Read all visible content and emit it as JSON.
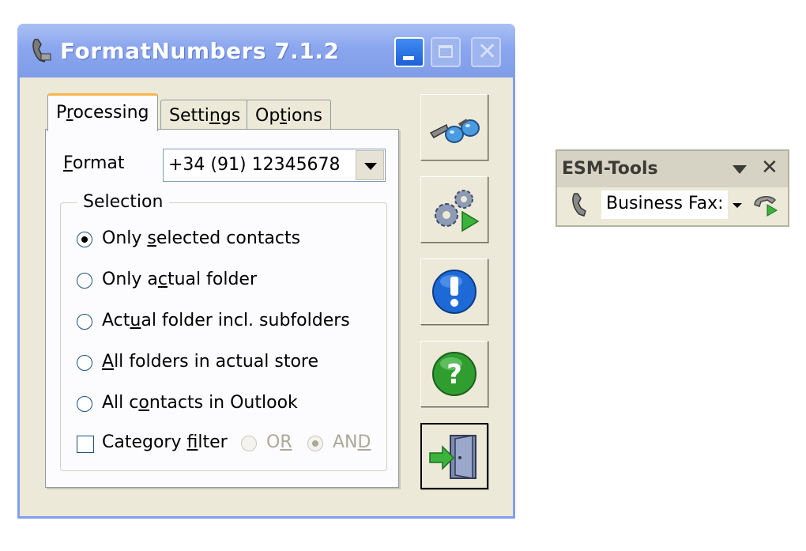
{
  "window": {
    "title": "FormatNumbers 7.1.2",
    "controls": {
      "minimize": "minimize",
      "maximize": "maximize",
      "close": "close"
    }
  },
  "tabs": [
    {
      "pre": "P",
      "ul": "r",
      "post": "ocessing"
    },
    {
      "pre": "Setti",
      "ul": "n",
      "post": "gs"
    },
    {
      "pre": "Op",
      "ul": "t",
      "post": "ions"
    }
  ],
  "format": {
    "label_ul": "F",
    "label_rest": "ormat",
    "value": "+34 (91) 12345678"
  },
  "selection": {
    "title": "Selection",
    "options": [
      {
        "pre": "Only ",
        "ul": "s",
        "post": "elected contacts",
        "selected": true
      },
      {
        "pre": "Only a",
        "ul": "c",
        "post": "tual folder",
        "selected": false
      },
      {
        "pre": "Act",
        "ul": "u",
        "post": "al folder incl. subfolders",
        "selected": false
      },
      {
        "pre": "",
        "ul": "A",
        "post": "ll folders in actual store",
        "selected": false
      },
      {
        "pre": "All c",
        "ul": "o",
        "post": "ntacts in Outlook",
        "selected": false
      }
    ],
    "category_filter": {
      "pre": "Category ",
      "ul": "f",
      "post": "ilter",
      "checked": false
    },
    "or": {
      "pre": "O",
      "ul": "R",
      "post": ""
    },
    "and": {
      "pre": "AN",
      "ul": "D",
      "post": ""
    }
  },
  "side_buttons": [
    "binoculars-icon",
    "gears-play-icon",
    "info-exclamation-icon",
    "help-question-icon",
    "exit-door-icon"
  ],
  "esm_tools": {
    "title": "ESM-Tools",
    "field_value": "Business Fax:"
  },
  "colors": {
    "titlebar": "#8aa6ee",
    "window_bg": "#ece9d8",
    "tab_highlight": "#f7b64a",
    "info_blue": "#1d6ad6",
    "help_green": "#2f9e2f"
  }
}
